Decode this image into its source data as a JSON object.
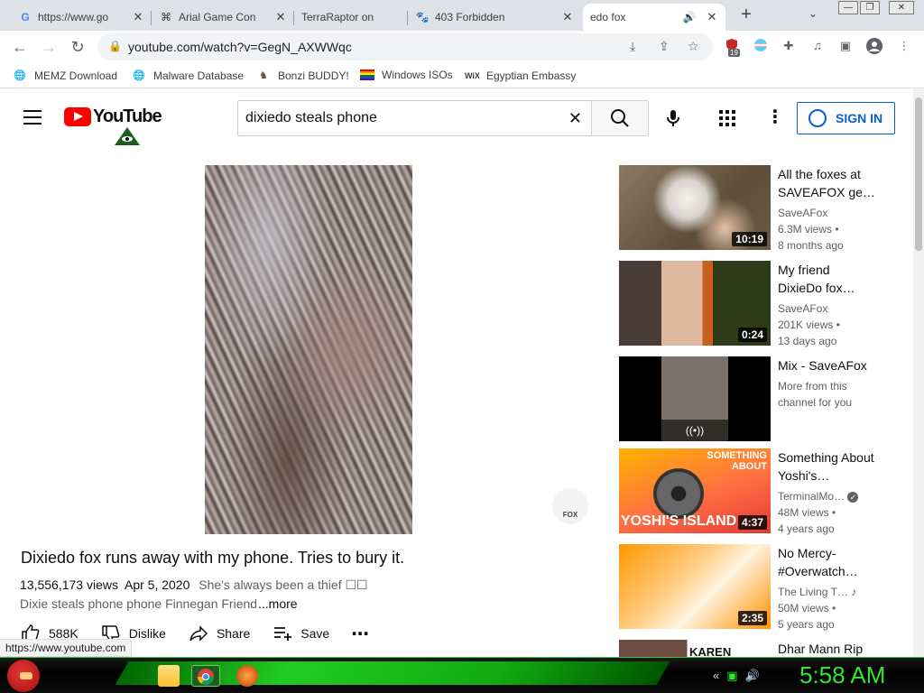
{
  "browser": {
    "tabs": [
      {
        "title": "https://www.go",
        "icon": "google-icon"
      },
      {
        "title": "Arial Game Con",
        "icon": "site-icon"
      },
      {
        "title": "TerraRaptor on",
        "icon": "site-icon"
      },
      {
        "title": "403 Forbidden",
        "icon": "paw-icon"
      },
      {
        "title": "edo fox",
        "icon": "audio-icon",
        "active": true
      }
    ],
    "url": "youtube.com/watch?v=GegN_AXWWqc",
    "extension_badge": "19",
    "bookmarks": [
      {
        "label": "MEMZ Download"
      },
      {
        "label": "Malware Database"
      },
      {
        "label": "Bonzi BUDDY!"
      },
      {
        "label": "Windows ISOs"
      },
      {
        "label": "Egyptian Embassy"
      }
    ]
  },
  "youtube": {
    "logo_text": "YouTube",
    "search_query": "dixiedo steals phone",
    "signin_label": "SIGN IN",
    "video": {
      "title": "Dixiedo fox runs away with my phone. Tries to bury it.",
      "views": "13,556,173 views",
      "date": "Apr 5, 2020",
      "tagline": "She's always been a thief ☐☐",
      "description": "Dixie steals phone phone Finnegan Friend",
      "more": "...more",
      "watermark": "FOX",
      "actions": {
        "like": "588K",
        "dislike": "Dislike",
        "share": "Share",
        "save": "Save"
      }
    },
    "related": [
      {
        "title": "All the foxes at SAVEAFOX ge…",
        "channel": "SaveAFox",
        "views": "6.3M views •",
        "age": "8 months ago",
        "duration": "10:19"
      },
      {
        "title": "My friend DixieDo fox…",
        "channel": "SaveAFox",
        "views": "201K views •",
        "age": "13 days ago",
        "duration": "0:24"
      },
      {
        "title": "Mix - SaveAFox",
        "subtitle": "More from this channel for you"
      },
      {
        "title": "Something About Yoshi's…",
        "channel": "TerminalMo…",
        "views": "48M views •",
        "age": "4 years ago",
        "duration": "4:37",
        "thumb_top": "SOMETHING ABOUT",
        "thumb_text": "YOSHI'S ISLAND"
      },
      {
        "title": "No Mercy- #Overwatch…",
        "channel": "The Living T…",
        "views": "50M views •",
        "age": "5 years ago",
        "duration": "2:35"
      },
      {
        "title": "Dhar Mann Rip",
        "thumb_text": "KAREN BREAKS"
      }
    ]
  },
  "status_url": "https://www.youtube.com",
  "taskbar": {
    "clock": "5:58 AM"
  }
}
